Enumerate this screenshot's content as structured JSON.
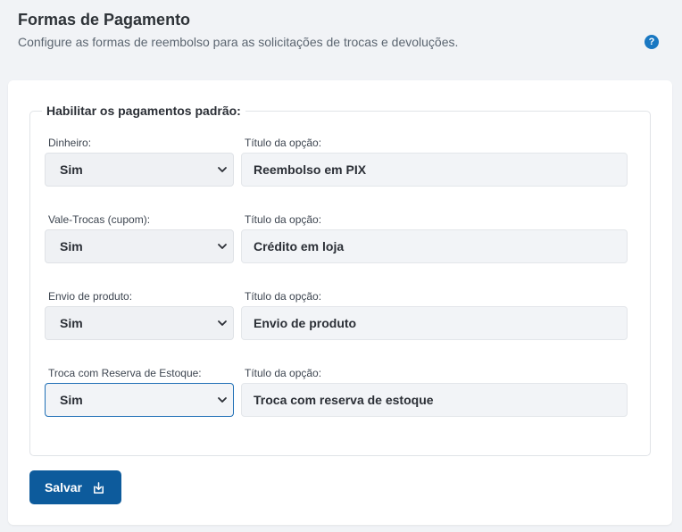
{
  "header": {
    "title": "Formas de Pagamento",
    "subtitle": "Configure as formas de reembolso para as solicitações de trocas e devoluções.",
    "help_label": "?"
  },
  "form": {
    "legend": "Habilitar os pagamentos padrão:",
    "rows": [
      {
        "label": "Dinheiro:",
        "select_value": "Sim",
        "title_label": "Título da opção:",
        "title_value": "Reembolso em PIX"
      },
      {
        "label": "Vale-Trocas (cupom):",
        "select_value": "Sim",
        "title_label": "Título da opção:",
        "title_value": "Crédito em loja"
      },
      {
        "label": "Envio de produto:",
        "select_value": "Sim",
        "title_label": "Título da opção:",
        "title_value": "Envio de produto"
      },
      {
        "label": "Troca com Reserva de Estoque:",
        "select_value": "Sim",
        "title_label": "Título da opção:",
        "title_value": "Troca com reserva de estoque"
      }
    ],
    "save_label": "Salvar"
  },
  "colors": {
    "accent": "#1a78c2",
    "button": "#0d5b9c",
    "focus_border": "#1f6fb6",
    "background": "#f1f3f6"
  },
  "icons": {
    "help": "question-circle-icon",
    "chevron": "chevron-down-icon",
    "save": "download-tray-icon"
  }
}
